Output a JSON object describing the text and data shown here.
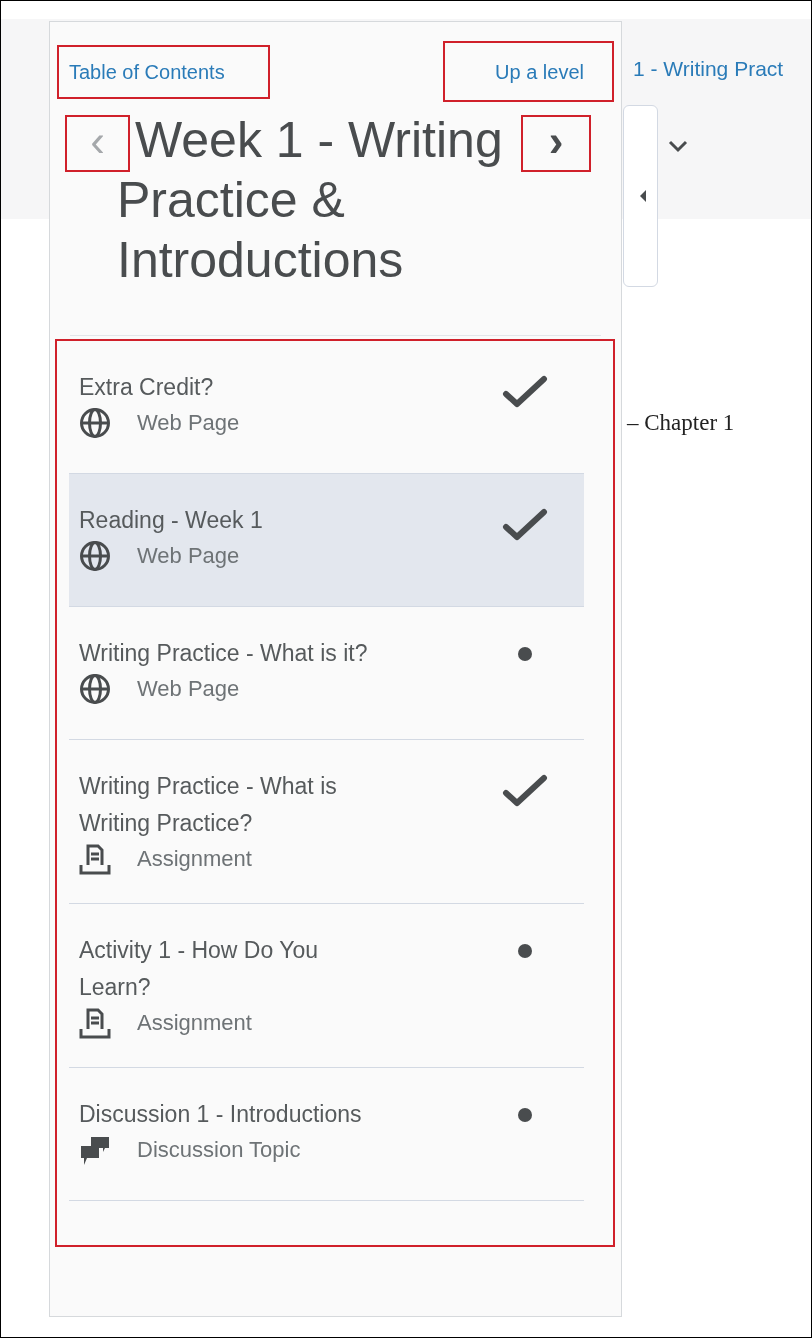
{
  "background": {
    "breadcrumb": "1 - Writing Pract",
    "content_text": "– Chapter 1"
  },
  "panel": {
    "toc_link": "Table of Contents",
    "up_link": "Up a level",
    "prev": "‹",
    "next": "›",
    "title": "Week 1 - Writing Practice & Introductions"
  },
  "items": [
    {
      "title": "Extra Credit?",
      "kind": "web",
      "type": "Web Page",
      "completed": true,
      "selected": false
    },
    {
      "title": "Reading - Week 1",
      "kind": "web",
      "type": "Web Page",
      "completed": true,
      "selected": true
    },
    {
      "title": "Writing Practice - What is it?",
      "kind": "web",
      "type": "Web Page",
      "completed": false,
      "selected": false
    },
    {
      "title": "Writing Practice - What is Writing Practice?",
      "kind": "assignment",
      "type": "Assignment",
      "completed": true,
      "selected": false
    },
    {
      "title": "Activity 1 - How Do You Learn?",
      "kind": "assignment",
      "type": "Assignment",
      "completed": false,
      "selected": false
    },
    {
      "title": "Discussion 1 - Introductions",
      "kind": "discussion",
      "type": "Discussion Topic",
      "completed": false,
      "selected": false
    }
  ]
}
